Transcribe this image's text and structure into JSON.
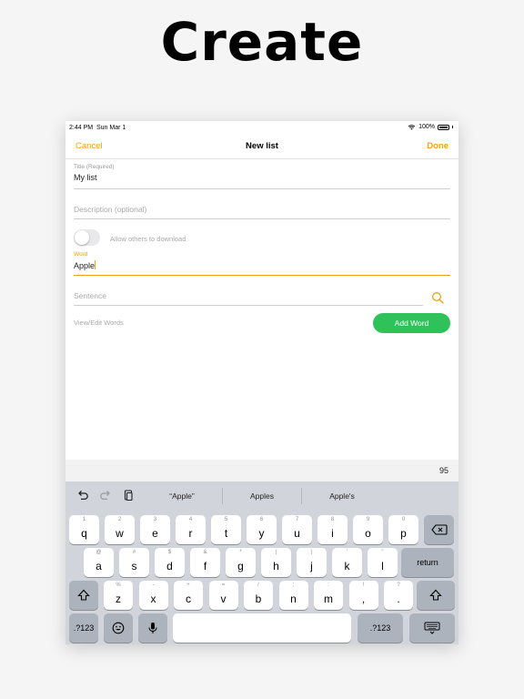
{
  "headline": "Create",
  "status": {
    "time": "2:44 PM",
    "date": "Sun Mar 1",
    "battery": "100%"
  },
  "nav": {
    "cancel": "Cancel",
    "title": "New list",
    "done": "Done"
  },
  "form": {
    "title_label": "Title (Required)",
    "title_value": "My list",
    "description_placeholder": "Description (optional)",
    "allow_download_label": "Allow others to download",
    "allow_download_on": false,
    "word_label": "Word",
    "word_value": "Apple",
    "sentence_placeholder": "Sentence",
    "view_edit": "View/Edit Words",
    "add_word": "Add Word"
  },
  "counter": "95",
  "keyboard": {
    "suggestions": [
      "“Apple”",
      "Apples",
      "Apple's"
    ],
    "row1": [
      {
        "sub": "1",
        "main": "q"
      },
      {
        "sub": "2",
        "main": "w"
      },
      {
        "sub": "3",
        "main": "e"
      },
      {
        "sub": "4",
        "main": "r"
      },
      {
        "sub": "5",
        "main": "t"
      },
      {
        "sub": "6",
        "main": "y"
      },
      {
        "sub": "7",
        "main": "u"
      },
      {
        "sub": "8",
        "main": "i"
      },
      {
        "sub": "9",
        "main": "o"
      },
      {
        "sub": "0",
        "main": "p"
      }
    ],
    "row2": [
      {
        "sub": "@",
        "main": "a"
      },
      {
        "sub": "#",
        "main": "s"
      },
      {
        "sub": "$",
        "main": "d"
      },
      {
        "sub": "&",
        "main": "f"
      },
      {
        "sub": "*",
        "main": "g"
      },
      {
        "sub": "(",
        "main": "h"
      },
      {
        "sub": ")",
        "main": "j"
      },
      {
        "sub": "'",
        "main": "k"
      },
      {
        "sub": "\"",
        "main": "l"
      }
    ],
    "return_label": "return",
    "row3": [
      {
        "sub": "%",
        "main": "z"
      },
      {
        "sub": "-",
        "main": "x"
      },
      {
        "sub": "+",
        "main": "c"
      },
      {
        "sub": "=",
        "main": "v"
      },
      {
        "sub": "/",
        "main": "b"
      },
      {
        "sub": ";",
        "main": "n"
      },
      {
        "sub": ":",
        "main": "m"
      },
      {
        "sub": "!",
        "main": ","
      },
      {
        "sub": "?",
        "main": "."
      }
    ],
    "numbers_label": ".?123"
  },
  "colors": {
    "accent": "#f3a013",
    "add_button": "#30c25a",
    "keyboard_bg": "#d1d4da"
  }
}
